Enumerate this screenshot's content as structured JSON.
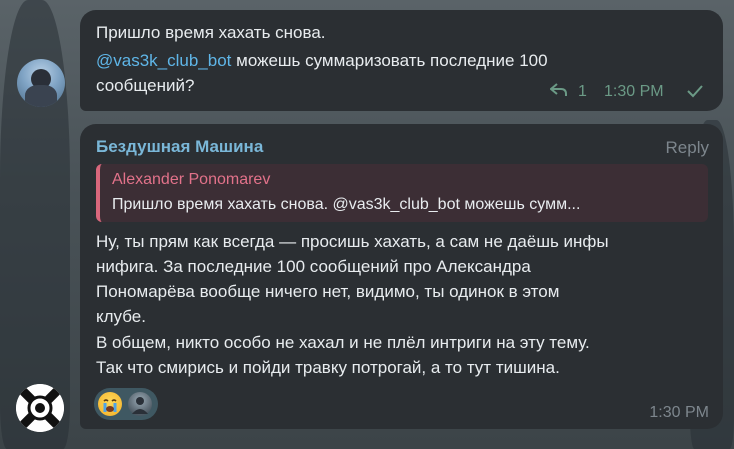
{
  "message1": {
    "line1": "Пришло время хахать снова.",
    "mention": "@vas3k_club_bot",
    "line2_rest": " можешь суммаризовать последние 100",
    "line3": "сообщений?",
    "reply_icon": "reply-arrow-icon",
    "reply_count": "1",
    "time": "1:30 PM",
    "status_icon": "check-icon"
  },
  "message2": {
    "sender": "Бездушная Машина",
    "reply_label": "Reply",
    "quote": {
      "author": "Alexander Ponomarev",
      "text": "Пришло время хахать снова. @vas3k_club_bot можешь сумм..."
    },
    "lines": [
      "Ну, ты прям как всегда — просишь хахать, а сам не даёшь инфы",
      "нифига. За последние 100 сообщений про Александра",
      "Пономарёва вообще ничего нет, видимо, ты одинок в этом",
      "клубе.",
      "В общем, никто особо не хахал и не плёл интриги на эту тему.",
      "Так что смирись и пойди травку потрогай, а то тут тишина."
    ],
    "reactions": [
      "crying-face-emoji",
      "user-avatar-reaction"
    ],
    "time": "1:30 PM"
  },
  "colors": {
    "bubble": "#2b2f33",
    "mention": "#5fb6e8",
    "sender": "#7ab7d8",
    "quote_accent": "#d9677c",
    "meta_green": "#6b9a86"
  }
}
